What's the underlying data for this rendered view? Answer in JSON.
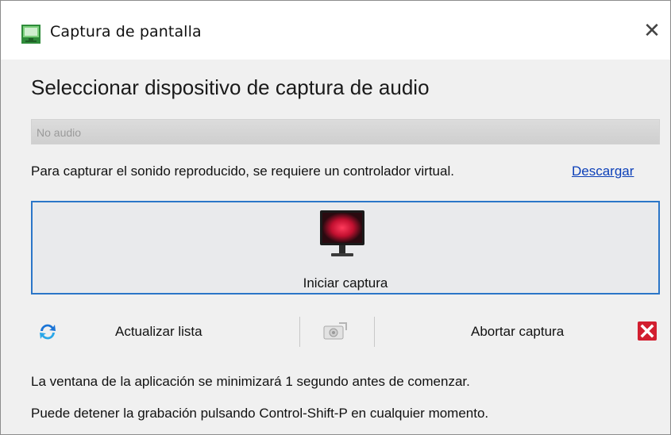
{
  "window": {
    "title": "Captura de pantalla",
    "close_glyph": "✕",
    "icons": {
      "app": "screen-capture-app-icon",
      "close": "close-icon"
    }
  },
  "main": {
    "heading": "Seleccionar dispositivo de captura de audio",
    "device_select": {
      "selected": "No audio"
    },
    "info_text": "Para capturar el sonido reproducido, se requiere un controlador virtual.",
    "download_link": "Descargar",
    "start_button": {
      "label": "Iniciar captura",
      "icon": "monitor-record-icon"
    },
    "toolbar": {
      "refresh_label": "Actualizar lista",
      "refresh_icon": "refresh-icon",
      "capture_settings_icon": "capture-settings-icon",
      "abort_label": "Abortar captura",
      "abort_icon": "abort-x-icon"
    },
    "footer": [
      "La ventana de la aplicación se minimizará 1 segundo antes de comenzar.",
      "Puede detener la grabación pulsando Control-Shift-P en cualquier momento."
    ]
  },
  "colors": {
    "accent_border": "#2b76c8",
    "link": "#0b3fb8",
    "abort_red": "#d21f30"
  }
}
